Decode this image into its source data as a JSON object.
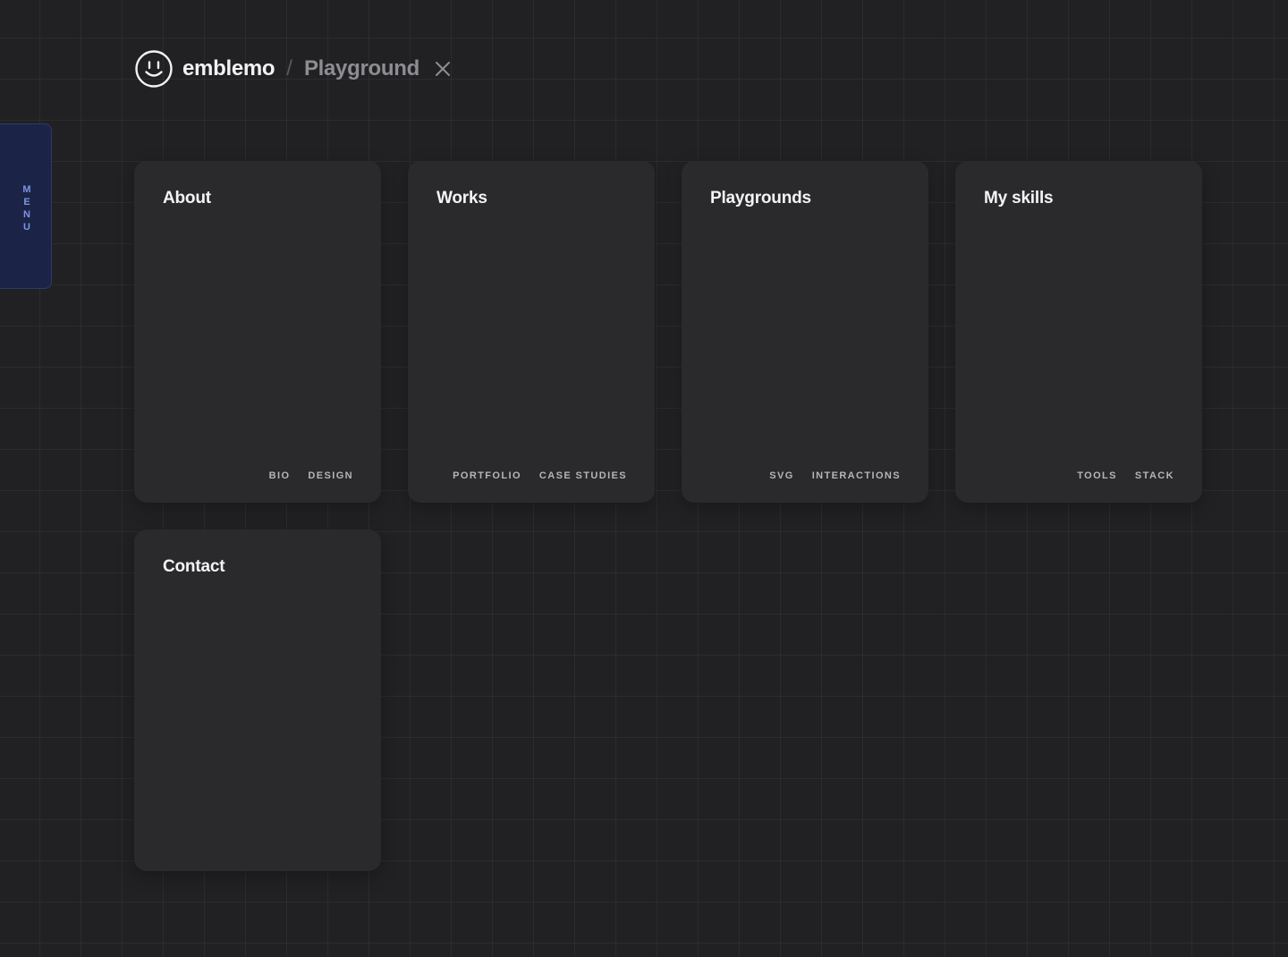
{
  "header": {
    "brand": "emblemo",
    "separator": "/",
    "breadcrumb": "Playground",
    "close_icon": "close-icon",
    "logo_icon": "smiley-logo-icon"
  },
  "menu": {
    "letters": [
      "M",
      "E",
      "N",
      "U"
    ]
  },
  "cards": [
    {
      "title": "About",
      "tags": [
        "BIO",
        "DESIGN"
      ]
    },
    {
      "title": "Works",
      "tags": [
        "PORTFOLIO",
        "CASE STUDIES"
      ]
    },
    {
      "title": "Playgrounds",
      "tags": [
        "SVG",
        "INTERACTIONS"
      ]
    },
    {
      "title": "My skills",
      "tags": [
        "TOOLS",
        "STACK"
      ]
    },
    {
      "title": "Contact",
      "tags": []
    }
  ],
  "colors": {
    "background": "#212123",
    "card": "#2a2a2c",
    "menu_tab": "#1b2446",
    "menu_text": "#7d93e6"
  }
}
